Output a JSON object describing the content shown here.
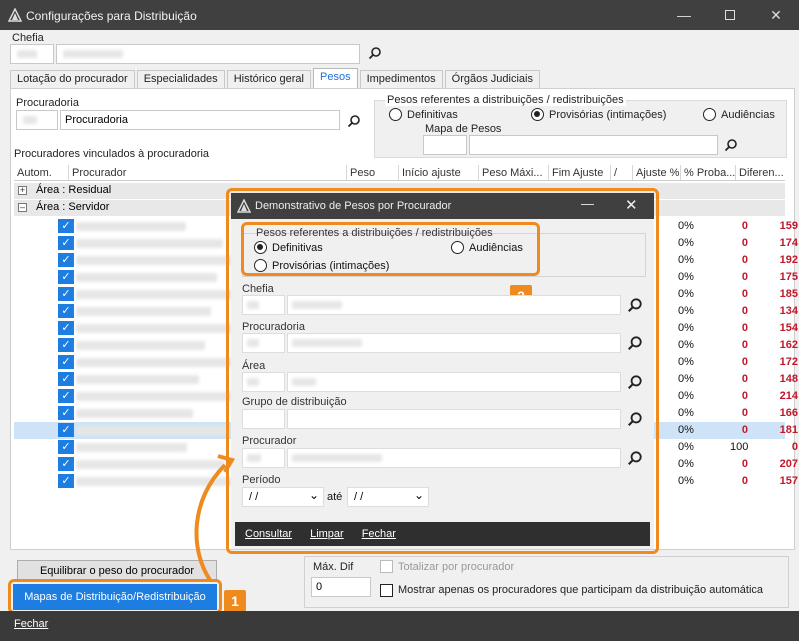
{
  "window": {
    "title": "Configurações para Distribuição"
  },
  "chefia": {
    "label": "Chefia"
  },
  "tabs": [
    "Lotação do procurador",
    "Especialidades",
    "Histórico geral",
    "Pesos",
    "Impedimentos",
    "Órgãos Judiciais"
  ],
  "active_tab": "Pesos",
  "procuradoria": {
    "label": "Procuradoria",
    "value": "Procuradoria"
  },
  "pesos_group": {
    "label": "Pesos referentes a distribuições / redistribuições",
    "options": [
      "Definitivas",
      "Provisórias (intimações)",
      "Audiências"
    ],
    "selected": "Provisórias (intimações)"
  },
  "mapa_de_pesos": {
    "label": "Mapa de Pesos"
  },
  "vinculados_label": "Procuradores vinculados à procuradoria",
  "grid": {
    "headers": [
      "Autom.",
      "Procurador",
      "Peso",
      "Início ajuste",
      "Peso Máxi...",
      "Fim Ajuste",
      "/",
      "Ajuste %",
      "% Proba...",
      "Diferen..."
    ],
    "groups": [
      "Área : Residual",
      "Área : Servidor"
    ],
    "rows": [
      {
        "pct": "0%",
        "z": "0",
        "dif": "159"
      },
      {
        "pct": "0%",
        "z": "0",
        "dif": "174"
      },
      {
        "pct": "0%",
        "z": "0",
        "dif": "192"
      },
      {
        "pct": "0%",
        "z": "0",
        "dif": "175"
      },
      {
        "pct": "0%",
        "z": "0",
        "dif": "185"
      },
      {
        "pct": "0%",
        "z": "0",
        "dif": "134"
      },
      {
        "pct": "0%",
        "z": "0",
        "dif": "154"
      },
      {
        "pct": "0%",
        "z": "0",
        "dif": "162"
      },
      {
        "pct": "0%",
        "z": "0",
        "dif": "172"
      },
      {
        "pct": "0%",
        "z": "0",
        "dif": "148"
      },
      {
        "pct": "0%",
        "z": "0",
        "dif": "214"
      },
      {
        "pct": "0%",
        "z": "0",
        "dif": "166"
      },
      {
        "pct": "0%",
        "z": "0",
        "dif": "181"
      },
      {
        "pct": "0%",
        "z": "100",
        "dif": "0"
      },
      {
        "pct": "0%",
        "z": "0",
        "dif": "207"
      },
      {
        "pct": "0%",
        "z": "0",
        "dif": "157"
      }
    ]
  },
  "buttons": {
    "equilibrar": "Equilibrar o peso do procurador",
    "mapas": "Mapas de Distribuição/Redistribuição"
  },
  "max_dif": {
    "label": "Máx. Dif",
    "value": "0"
  },
  "checks": {
    "totalizar": "Totalizar por procurador",
    "mostrar": "Mostrar apenas os procuradores que participam da distribuição automática"
  },
  "footer": {
    "fechar": "Fechar"
  },
  "dialog": {
    "title": "Demonstrativo de Pesos por Procurador",
    "group_label": "Pesos referentes a distribuições / redistribuições",
    "options": [
      "Definitivas",
      "Audiências",
      "Provisórias (intimações)"
    ],
    "selected": "Definitivas",
    "fields": [
      "Chefia",
      "Procuradoria",
      "Área",
      "Grupo de distribuição",
      "Procurador"
    ],
    "periodo": {
      "label": "Período",
      "from": " / /",
      "to": " / /",
      "sep": "até"
    },
    "footer": [
      "Consultar",
      "Limpar",
      "Fechar"
    ]
  },
  "callouts": [
    "1",
    "2"
  ],
  "colors": {
    "accent": "#1e7de1",
    "callout": "#ef8a1f",
    "red": "#c0182b",
    "titlebar": "#404040"
  }
}
